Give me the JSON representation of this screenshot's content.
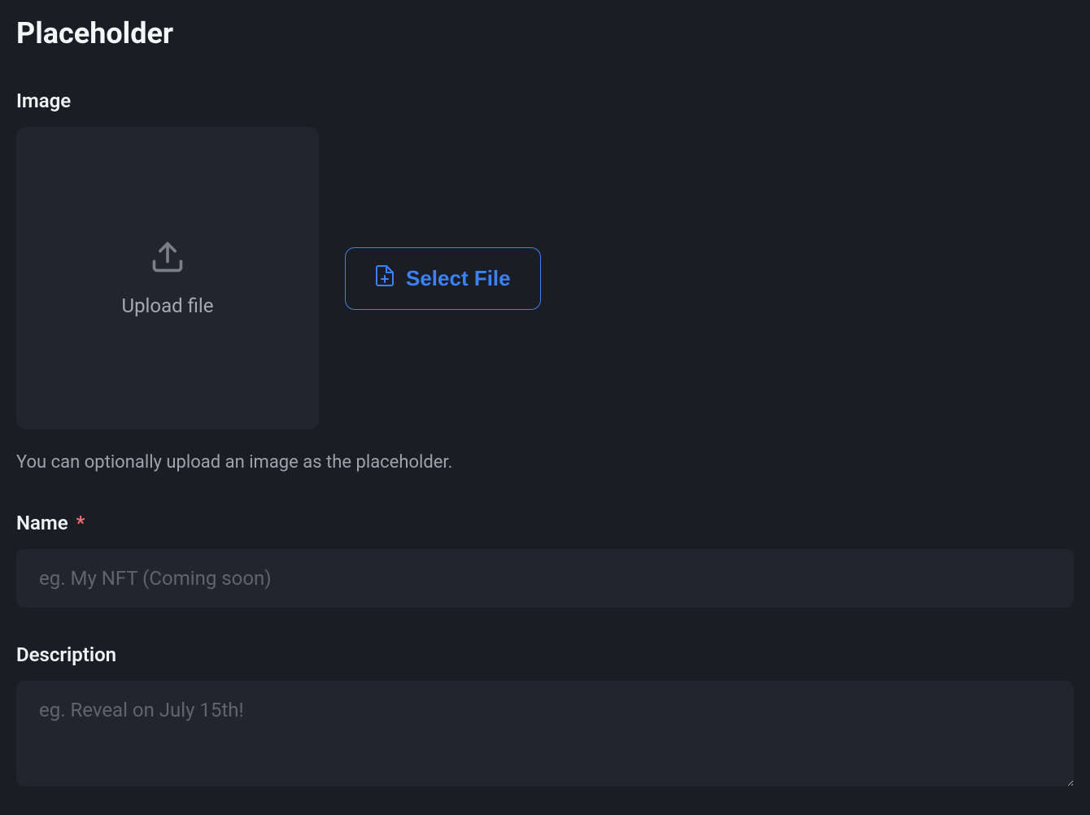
{
  "title": "Placeholder",
  "image_field": {
    "label": "Image",
    "drop_label": "Upload file",
    "button_label": "Select File",
    "help_text": "You can optionally upload an image as the placeholder."
  },
  "name_field": {
    "label": "Name",
    "required_mark": "*",
    "placeholder": "eg. My NFT (Coming soon)",
    "value": ""
  },
  "description_field": {
    "label": "Description",
    "placeholder": "eg. Reveal on July 15th!",
    "value": ""
  }
}
